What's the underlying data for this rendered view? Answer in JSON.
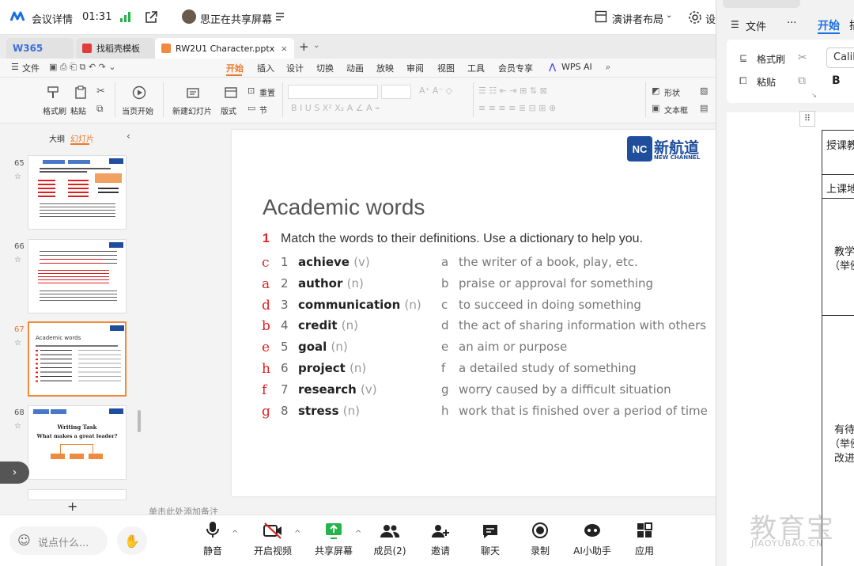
{
  "meeting": {
    "info_label": "会议详情",
    "time": "01:31",
    "sharing_text": "思正在共享屏幕",
    "layout_button": "演讲者布局",
    "settings_label": "设"
  },
  "app_tabs": [
    {
      "label": "W365"
    },
    {
      "label": "找稻壳模板"
    },
    {
      "label": "RW2U1 Character.pptx"
    }
  ],
  "menubar": {
    "file": "文件",
    "items": [
      "开始",
      "插入",
      "设计",
      "切换",
      "动画",
      "放映",
      "审阅",
      "视图",
      "工具",
      "会员专享",
      "WPS AI"
    ],
    "active": "开始"
  },
  "ribbon": {
    "format_painter": "格式刷",
    "paste": "粘贴",
    "play_from_current": "当页开始",
    "new_slide": "新建幻灯片",
    "layout": "版式",
    "reset": "重置",
    "section": "节",
    "shape": "形状",
    "textbox": "文本框"
  },
  "left_pane": {
    "tab_outline": "大纲",
    "tab_slides": "幻灯片",
    "slides": [
      {
        "num": "65"
      },
      {
        "num": "66"
      },
      {
        "num": "67",
        "title": "Academic words"
      },
      {
        "num": "68",
        "title": "Writing Task",
        "subtitle": "What makes a great leader?"
      }
    ],
    "add": "+"
  },
  "slide": {
    "title": "Academic words",
    "logo_cn": "新航道",
    "logo_en": "NEW CHANNEL",
    "instruction_num": "1",
    "instruction": "Match the words to their definitions. Use a dictionary to help you.",
    "rows": [
      {
        "answer": "c",
        "num": "1",
        "word": "achieve",
        "pos": "(v)",
        "letter": "a",
        "definition": "the writer of a book, play, etc."
      },
      {
        "answer": "a",
        "num": "2",
        "word": "author",
        "pos": "(n)",
        "letter": "b",
        "definition": "praise or approval for something"
      },
      {
        "answer": "d",
        "num": "3",
        "word": "communication",
        "pos": "(n)",
        "letter": "c",
        "definition": "to succeed in doing something"
      },
      {
        "answer": "b",
        "num": "4",
        "word": "credit",
        "pos": "(n)",
        "letter": "d",
        "definition": "the act of sharing information with others"
      },
      {
        "answer": "e",
        "num": "5",
        "word": "goal",
        "pos": "(n)",
        "letter": "e",
        "definition": "an aim or purpose"
      },
      {
        "answer": "h",
        "num": "6",
        "word": "project",
        "pos": "(n)",
        "letter": "f",
        "definition": "a detailed study of something"
      },
      {
        "answer": "f",
        "num": "7",
        "word": "research",
        "pos": "(v)",
        "letter": "g",
        "definition": "worry caused by a difficult situation"
      },
      {
        "answer": "g",
        "num": "8",
        "word": "stress",
        "pos": "(n)",
        "letter": "h",
        "definition": "work that is finished over a period of time"
      }
    ]
  },
  "notes_placeholder": "单击此处添加备注",
  "right_panel": {
    "file": "文件",
    "more": "···",
    "start_tab": "开始",
    "tab2": "插",
    "format_painter": "格式刷",
    "paste": "粘贴",
    "font": "Calib",
    "bold": "B",
    "table": [
      "授课教",
      "上课地",
      "教学",
      "（举例",
      "有待",
      "（举例",
      "改进"
    ]
  },
  "bottom_bar": {
    "chat_placeholder": "说点什么...",
    "buttons": [
      "静音",
      "开启视频",
      "共享屏幕",
      "成员(2)",
      "邀请",
      "聊天",
      "录制",
      "AI小助手",
      "应用"
    ]
  },
  "watermark": {
    "cn": "教育宝",
    "en": "JIAOYUBAO.CN"
  },
  "colors": {
    "accent": "#e8782c",
    "wps_red": "#e02020",
    "meeting_blue": "#1a6fe0",
    "ppt_orange": "#f08a3c"
  }
}
